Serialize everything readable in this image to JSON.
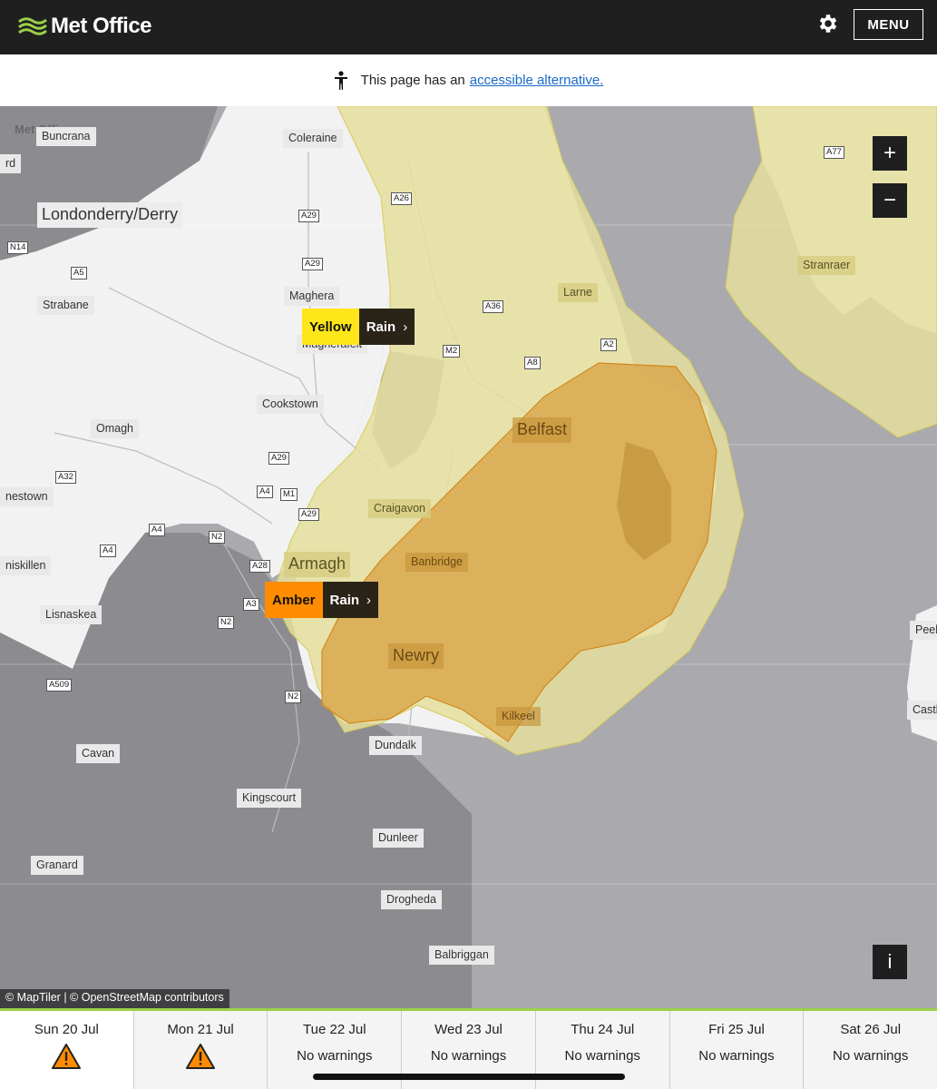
{
  "header": {
    "brand": "Met Office",
    "menu_label": "MENU"
  },
  "accessibility": {
    "text": "This page has an",
    "link": "accessible alternative."
  },
  "map": {
    "watermark": "Met Office",
    "attribution": "© MapTiler | © OpenStreetMap contributors",
    "zoom_in": "+",
    "zoom_out": "−",
    "info": "i",
    "places": {
      "buncrana": "Buncrana",
      "rd": "rd",
      "coleraine": "Coleraine",
      "londonderry": "Londonderry/Derry",
      "strabane": "Strabane",
      "maghera": "Maghera",
      "magherafelt": "Magherafelt",
      "larne": "Larne",
      "stranraer": "Stranraer",
      "cookstown": "Cookstown",
      "omagh": "Omagh",
      "belfast": "Belfast",
      "craigavon": "Craigavon",
      "nestown": "nestown",
      "armagh": "Armagh",
      "banbridge": "Banbridge",
      "niskillen": "niskillen",
      "lisnaskea": "Lisnaskea",
      "newry": "Newry",
      "kilkeel": "Kilkeel",
      "dundalk": "Dundalk",
      "cavan": "Cavan",
      "kingscourt": "Kingscourt",
      "dunleer": "Dunleer",
      "granard": "Granard",
      "drogheda": "Drogheda",
      "balbriggan": "Balbriggan",
      "peel": "Peel",
      "castletown": "Castl"
    },
    "roads": {
      "n14": "N14",
      "a5": "A5",
      "a29a": "A29",
      "a29b": "A29",
      "a29c": "A29",
      "a29d": "A29",
      "a26": "A26",
      "a36": "A36",
      "m2": "M2",
      "a8": "A8",
      "a2": "A2",
      "a77": "A77",
      "a32": "A32",
      "a4a": "A4",
      "a4b": "A4",
      "a4c": "A4",
      "m1": "M1",
      "n2a": "N2",
      "n2b": "N2",
      "n2c": "N2",
      "a28": "A28",
      "a3": "A3",
      "a509": "A509"
    },
    "warnings": [
      {
        "level": "Yellow",
        "type": "Rain",
        "color": "#ffe61a"
      },
      {
        "level": "Amber",
        "type": "Rain",
        "color": "#ff8c00"
      }
    ]
  },
  "days": [
    {
      "label": "Sun 20 Jul",
      "status": "warning",
      "active": true
    },
    {
      "label": "Mon 21 Jul",
      "status": "warning",
      "active": false
    },
    {
      "label": "Tue 22 Jul",
      "status": "No warnings",
      "active": false
    },
    {
      "label": "Wed 23 Jul",
      "status": "No warnings",
      "active": false
    },
    {
      "label": "Thu 24 Jul",
      "status": "No warnings",
      "active": false
    },
    {
      "label": "Fri 25 Jul",
      "status": "No warnings",
      "active": false
    },
    {
      "label": "Sat 26 Jul",
      "status": "No warnings",
      "active": false
    }
  ],
  "colors": {
    "header_bg": "#1f1f1f",
    "sea": "#a9a9ae",
    "land_uk": "#f2f2f2",
    "land_roi": "#8a8a8e",
    "yellow_area": "#e8e2a8",
    "amber_area": "#d9ae5a",
    "link": "#1b6ac9",
    "accent": "#9ad04a"
  },
  "icons": [
    "met-office-logo-icon",
    "gear-icon",
    "accessibility-person-icon",
    "warning-triangle-icon",
    "chevron-right-icon"
  ]
}
